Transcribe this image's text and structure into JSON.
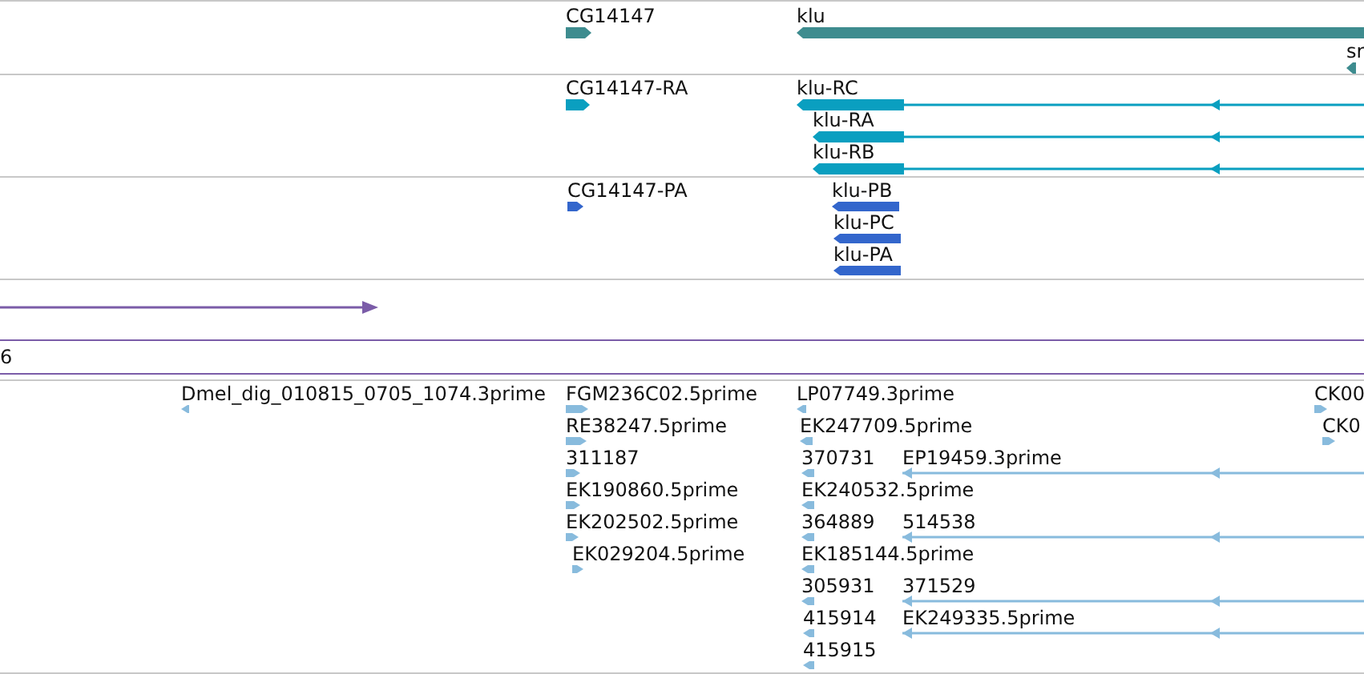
{
  "tracks": [
    {
      "kind": "gene",
      "color": "#3e8c8f",
      "features": [
        {
          "label": "CG14147",
          "reverse": false
        },
        {
          "label": "klu",
          "reverse": true
        },
        {
          "label": "sr",
          "reverse": true
        }
      ]
    },
    {
      "kind": "transcript",
      "color": "#0a9fc0",
      "features": [
        {
          "label": "CG14147-RA",
          "reverse": false
        },
        {
          "label": "klu-RC",
          "reverse": true
        },
        {
          "label": "klu-RA",
          "reverse": true
        },
        {
          "label": "klu-RB",
          "reverse": true
        }
      ]
    },
    {
      "kind": "protein",
      "color": "#3366cc",
      "features": [
        {
          "label": "CG14147-PA",
          "reverse": false
        },
        {
          "label": "klu-PB",
          "reverse": true
        },
        {
          "label": "klu-PC",
          "reverse": true
        },
        {
          "label": "klu-PA",
          "reverse": true
        }
      ]
    },
    {
      "kind": "region",
      "color": "#7b5ca8",
      "features": [
        {
          "reverse": false
        },
        {
          "label": "6"
        }
      ]
    },
    {
      "kind": "est",
      "color": "#88bbdd",
      "features": [
        {
          "label": "Dmel_dig_010815_0705_1074.3prime",
          "reverse": true
        },
        {
          "label": "FGM236C02.5prime",
          "reverse": false
        },
        {
          "label": "LP07749.3prime",
          "reverse": true
        },
        {
          "label": "CK00",
          "reverse": false
        },
        {
          "label": "RE38247.5prime",
          "reverse": false
        },
        {
          "label": "EK247709.5prime",
          "reverse": true
        },
        {
          "label": "CK0",
          "reverse": false
        },
        {
          "label": "311187",
          "reverse": false
        },
        {
          "label": "370731",
          "reverse": true
        },
        {
          "label": "EP19459.3prime",
          "reverse": true
        },
        {
          "label": "EK190860.5prime",
          "reverse": false
        },
        {
          "label": "EK240532.5prime",
          "reverse": true
        },
        {
          "label": "EK202502.5prime",
          "reverse": false
        },
        {
          "label": "364889",
          "reverse": true
        },
        {
          "label": "514538",
          "reverse": true
        },
        {
          "label": "EK029204.5prime",
          "reverse": false
        },
        {
          "label": "EK185144.5prime",
          "reverse": true
        },
        {
          "label": "305931",
          "reverse": true
        },
        {
          "label": "371529",
          "reverse": true
        },
        {
          "label": "415914",
          "reverse": true
        },
        {
          "label": "EK249335.5prime",
          "reverse": true
        },
        {
          "label": "415915",
          "reverse": true
        }
      ]
    }
  ]
}
